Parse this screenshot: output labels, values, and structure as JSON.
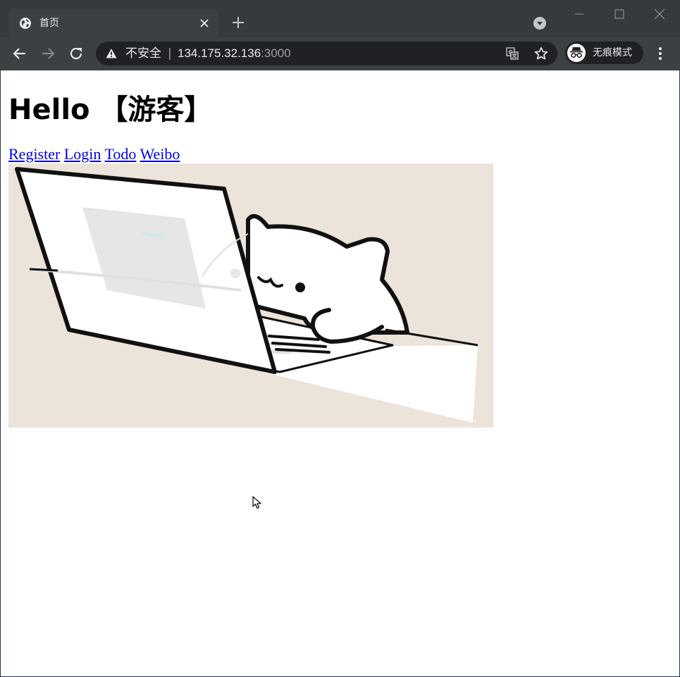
{
  "browser": {
    "tab": {
      "title": "首页",
      "favicon": "globe-icon"
    },
    "address": {
      "security_label": "不安全",
      "separator": "|",
      "host": "134.175.32.136",
      "port": ":3000"
    },
    "profile": {
      "label": "无痕模式",
      "icon": "incognito-icon"
    },
    "icons": {
      "back": "arrow-left-icon",
      "forward": "arrow-right-icon",
      "reload": "reload-icon",
      "translate": "translate-icon",
      "bookmark": "star-icon",
      "menu": "three-dots-icon",
      "new_tab": "plus-icon",
      "tab_search": "chevron-down-icon"
    },
    "colors": {
      "titlebar": "#36393e",
      "toolbar": "#3c4043",
      "omnibox": "#202124"
    }
  },
  "page": {
    "heading": "Hello 【游客】",
    "nav_links": [
      {
        "label": "Register"
      },
      {
        "label": "Login"
      },
      {
        "label": "Todo"
      },
      {
        "label": "Weibo"
      }
    ],
    "image": {
      "subject": "cat-typing-on-laptop-illustration",
      "background": "#ece3da"
    },
    "link_color": "#0000ee"
  }
}
